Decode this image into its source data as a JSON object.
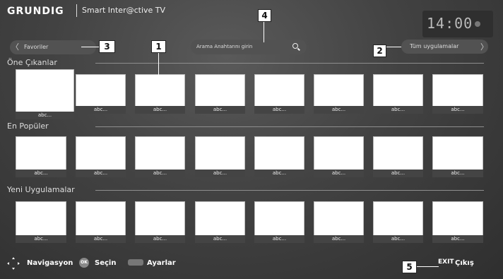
{
  "header": {
    "brand": "GRUNDIG",
    "subtitle": "Smart Inter@ctive TV",
    "clock": "14:00"
  },
  "nav": {
    "favorites_label": "Favoriler",
    "all_apps_label": "Tüm uygulamalar",
    "search_placeholder": "Arama Anahtarını girin"
  },
  "callouts": [
    "1",
    "2",
    "3",
    "4",
    "5"
  ],
  "sections": [
    {
      "title": "Öne Çıkanlar",
      "tiles": [
        "abc...",
        "abc...",
        "abc...",
        "abc...",
        "abc...",
        "abc...",
        "abc...",
        "abc..."
      ]
    },
    {
      "title": "En Popüler",
      "tiles": [
        "abc...",
        "abc...",
        "abc...",
        "abc...",
        "abc...",
        "abc...",
        "abc...",
        "abc..."
      ]
    },
    {
      "title": "Yeni Uygulamalar",
      "tiles": [
        "abc...",
        "abc...",
        "abc...",
        "abc...",
        "abc...",
        "abc...",
        "abc...",
        "abc..."
      ]
    }
  ],
  "footer": {
    "navigate": "Navigasyon",
    "ok_icon": "OK",
    "select": "Seçin",
    "settings": "Ayarlar",
    "exit_key": "EXIT",
    "exit": "Çıkış"
  },
  "icons": {
    "nav": "dpad-arrows-icon",
    "ok": "ok-button-icon",
    "settings": "grey-key-icon",
    "search": "search-icon"
  }
}
